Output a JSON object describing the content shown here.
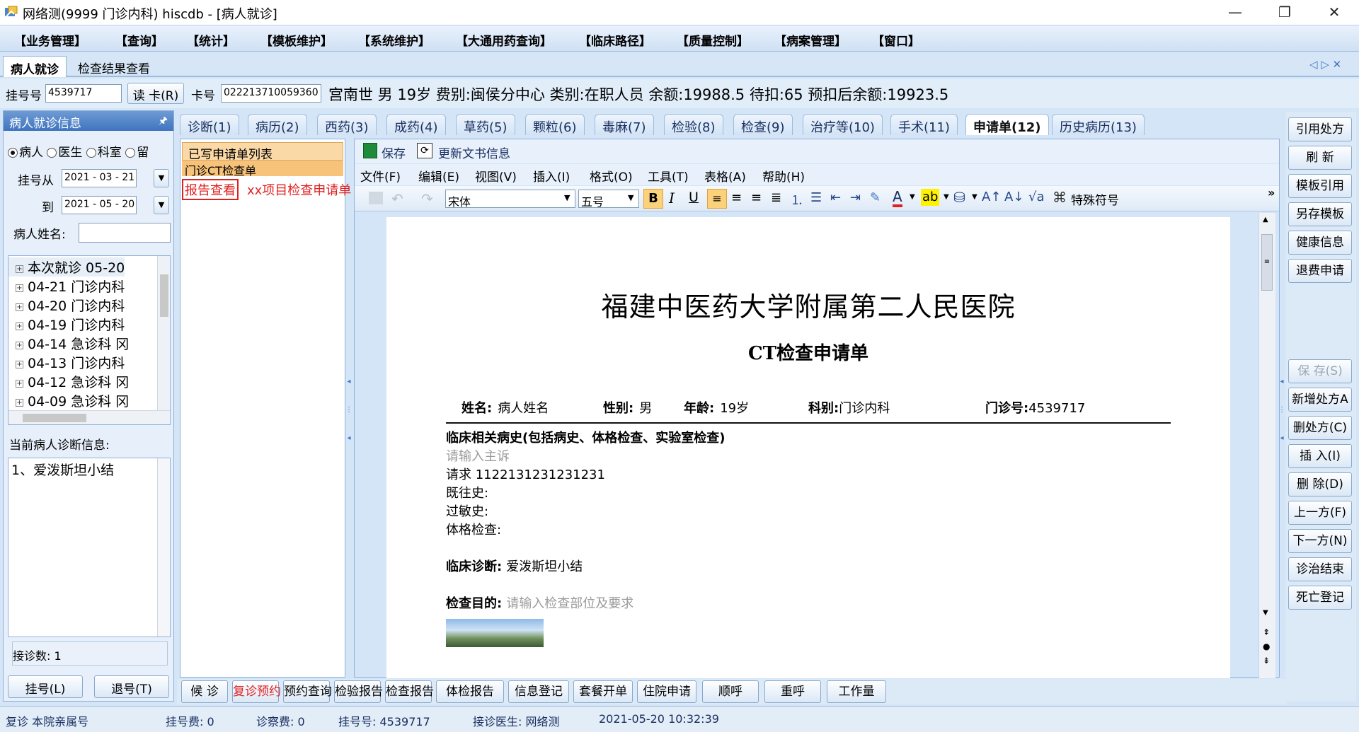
{
  "window": {
    "title": "网络测(9999 门诊内科)  hiscdb - [病人就诊]",
    "controls": [
      "—",
      "❐",
      "✕"
    ]
  },
  "menu": [
    "【业务管理】",
    "【查询】",
    "【统计】",
    "【模板维护】",
    "【系统维护】",
    "【大通用药查询】",
    "【临床路径】",
    "【质量控制】",
    "【病案管理】",
    "【窗口】"
  ],
  "doc_tabs": [
    {
      "label": "病人就诊",
      "active": true
    },
    {
      "label": "检查结果查看",
      "active": false
    }
  ],
  "doc_tab_nav": "◁ ▷ ✕",
  "patient": {
    "reg_label": "挂号号",
    "reg_value": "4539717",
    "read_card_label": "读 卡(R)",
    "card_label": "卡号",
    "card_value": "022213710059360",
    "info": "宫南世  男  19岁  费别:闽侯分中心  类别:在职人员  余额:19988.5  待扣:65  预扣后余额:19923.5"
  },
  "left_panel": {
    "header": "病人就诊信息",
    "pin": "🖈",
    "radios": [
      {
        "label": "病人",
        "checked": true
      },
      {
        "label": "医生",
        "checked": false
      },
      {
        "label": "科室",
        "checked": false
      },
      {
        "label": "留",
        "checked": false
      }
    ],
    "from_label": "挂号从",
    "from_value": "2021 - 03 - 21",
    "to_label": "到",
    "to_value": "2021 - 05 - 20",
    "name_label": "病人姓名:",
    "name_value": "",
    "visits": [
      "本次就诊  05-20",
      "04-21  门诊内科",
      "04-20  门诊内科",
      "04-19  门诊内科",
      "04-14  急诊科  冈",
      "04-13  门诊内科",
      "04-12  急诊科  冈",
      "04-09  急诊科  冈"
    ],
    "diag_label": "当前病人诊断信息:",
    "diag_items": [
      "1、爱泼斯坦小结"
    ],
    "count_label": "接诊数: 1",
    "reg_btn": "挂号(L)",
    "unreg_btn": "退号(T)"
  },
  "clinic_tabs": [
    {
      "label": "诊断(1)",
      "active": false
    },
    {
      "label": "病历(2)",
      "active": false
    },
    {
      "label": "西药(3)",
      "active": false
    },
    {
      "label": "成药(4)",
      "active": false
    },
    {
      "label": "草药(5)",
      "active": false
    },
    {
      "label": "颗粒(6)",
      "active": false
    },
    {
      "label": "毒麻(7)",
      "active": false
    },
    {
      "label": "检验(8)",
      "active": false
    },
    {
      "label": "检查(9)",
      "active": false
    },
    {
      "label": "治疗等(10)",
      "active": false
    },
    {
      "label": "手术(11)",
      "active": false
    },
    {
      "label": "申请单(12)",
      "active": true
    },
    {
      "label": "历史病历(13)",
      "active": false
    }
  ],
  "list_panel": {
    "header": "已写申请单列表",
    "selected": "门诊CT检查单",
    "report_link": "报告查看",
    "note": "xx项目检查申请单"
  },
  "editor": {
    "save": "保存",
    "update_doc": "更新文书信息",
    "menu": [
      "文件(F)",
      "编辑(E)",
      "视图(V)",
      "插入(I)",
      "格式(O)",
      "工具(T)",
      "表格(A)",
      "帮助(H)"
    ],
    "font_name": "宋体",
    "font_size": "五号",
    "special_chars": "特殊符号",
    "format_icons": [
      "B",
      "I",
      "U"
    ],
    "overflow": "»"
  },
  "document": {
    "hospital": "福建中医药大学附属第二人民医院",
    "form_title": "CT检查申请单",
    "name_label": "姓名:",
    "name_value": "病人姓名",
    "sex_label": "性别:",
    "sex_value": "男",
    "age_label": "年龄:",
    "age_value": "19岁",
    "dept_label": "科别:",
    "dept_value": "门诊内科",
    "clinic_no_label": "门诊号:",
    "clinic_no_value": "4539717",
    "history_title": "临床相关病史(包括病史、体格检查、实验室检查)",
    "complaint_placeholder": "请输入主诉",
    "request_line": "请求 1122131231231231",
    "past_history": "既往史:",
    "allergy": "过敏史:",
    "exam": "体格检查:",
    "diagnosis_label": "临床诊断:",
    "diagnosis_value": "爱泼斯坦小结",
    "purpose_label": "检查目的:",
    "purpose_placeholder": "请输入检查部位及要求"
  },
  "right_buttons_top": [
    "引用处方",
    "刷 新",
    "模板引用",
    "另存模板",
    "健康信息",
    "退费申请"
  ],
  "right_buttons_bottom": [
    {
      "label": "保 存(S)",
      "disabled": true
    },
    {
      "label": "新增处方A",
      "disabled": false
    },
    {
      "label": "删处方(C)",
      "disabled": false
    },
    {
      "label": "插 入(I)",
      "disabled": false
    },
    {
      "label": "删 除(D)",
      "disabled": false
    },
    {
      "label": "上一方(F)",
      "disabled": false
    },
    {
      "label": "下一方(N)",
      "disabled": false
    },
    {
      "label": "诊治结束",
      "disabled": false
    },
    {
      "label": "死亡登记",
      "disabled": false
    }
  ],
  "bottom_buttons": [
    {
      "label": "候 诊",
      "red": false
    },
    {
      "label": "复诊预约",
      "red": true
    },
    {
      "label": "预约查询",
      "red": false
    },
    {
      "label": "检验报告",
      "red": false
    },
    {
      "label": "检查报告",
      "red": false
    },
    {
      "label": "体检报告",
      "red": false
    },
    {
      "label": "信息登记",
      "red": false
    },
    {
      "label": "套餐开单",
      "red": false
    },
    {
      "label": "住院申请",
      "red": false
    },
    {
      "label": "顺呼",
      "red": false
    },
    {
      "label": "重呼",
      "red": false
    },
    {
      "label": "工作量",
      "red": false
    }
  ],
  "status": {
    "left": "复诊 本院亲属号",
    "reg_fee": "挂号费:   0",
    "consult_fee": "诊察费:  0",
    "reg_no": "挂号号:   4539717",
    "doctor": "接诊医生:   网络测",
    "datetime": "2021-05-20 10:32:39"
  },
  "colors": {
    "accent": "#3f74bf",
    "link_red": "#e02020",
    "placeholder": "#9a9a9a",
    "panel_bg": "#d4e5f7"
  }
}
